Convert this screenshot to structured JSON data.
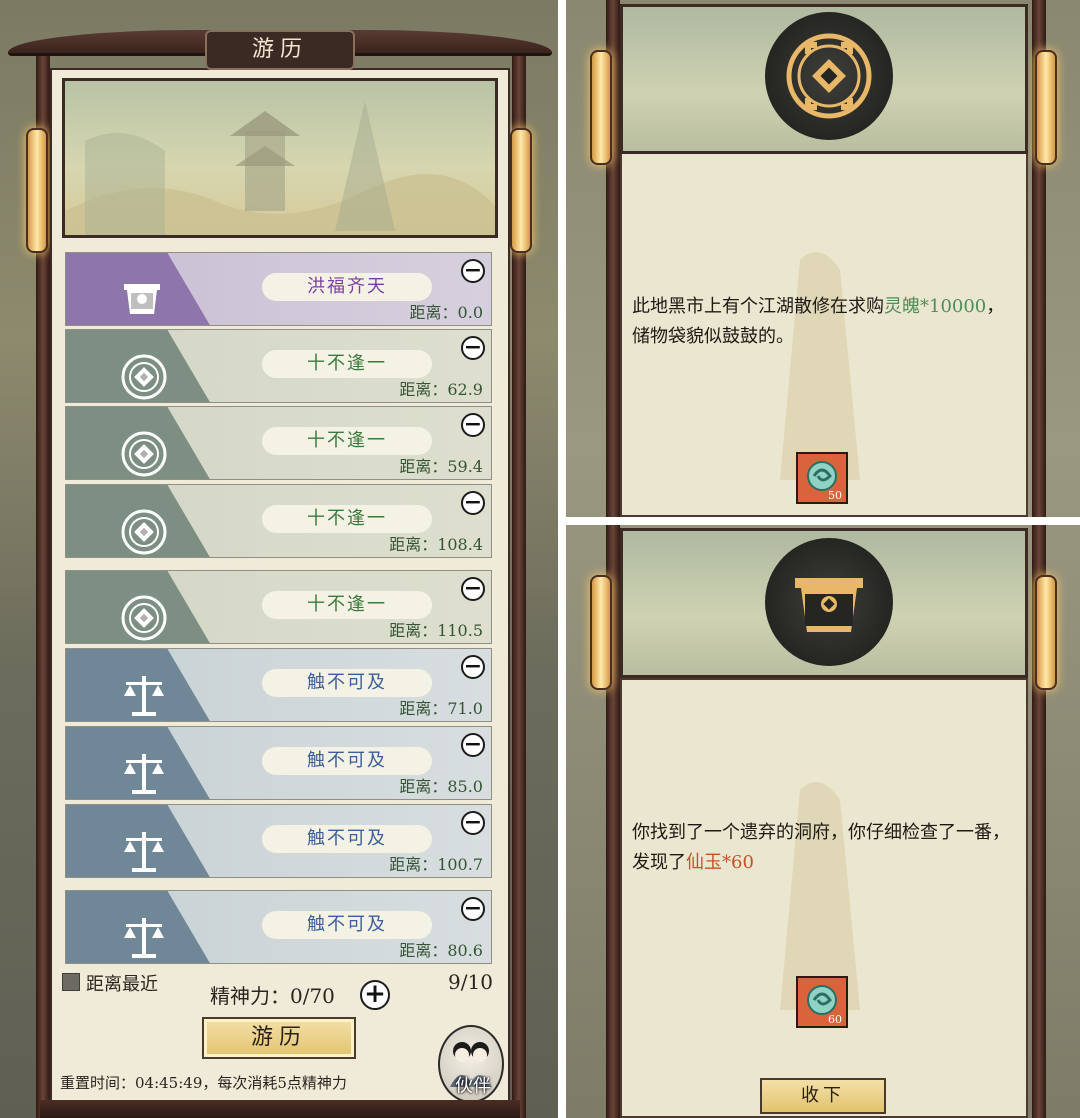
{
  "left_panel": {
    "title": "游历",
    "entries": [
      {
        "name": "洪福齐天",
        "distance": "距离：0.0",
        "color": "#7a3fa0",
        "style": "purple",
        "icon": "chest-icon"
      },
      {
        "name": "十不逢一",
        "distance": "距离：62.9",
        "color": "#3a7a3c",
        "style": "green",
        "icon": "coin-icon"
      },
      {
        "name": "十不逢一",
        "distance": "距离：59.4",
        "color": "#3a7a3c",
        "style": "green",
        "icon": "coin-icon"
      },
      {
        "name": "十不逢一",
        "distance": "距离：108.4",
        "color": "#3a7a3c",
        "style": "green",
        "icon": "coin-icon"
      },
      {
        "name": "十不逢一",
        "distance": "距离：110.5",
        "color": "#3a7a3c",
        "style": "green",
        "icon": "coin-icon"
      },
      {
        "name": "触不可及",
        "distance": "距离：71.0",
        "color": "#3d5e9c",
        "style": "blue",
        "icon": "scale-icon"
      },
      {
        "name": "触不可及",
        "distance": "距离：85.0",
        "color": "#3d5e9c",
        "style": "blue",
        "icon": "scale-icon"
      },
      {
        "name": "触不可及",
        "distance": "距离：100.7",
        "color": "#3d5e9c",
        "style": "blue",
        "icon": "scale-icon"
      },
      {
        "name": "触不可及",
        "distance": "距离：80.6",
        "color": "#3d5e9c",
        "style": "blue",
        "icon": "scale-icon"
      }
    ],
    "sort_label": "距离最近",
    "stamina_label": "精神力：0/70",
    "count": "9/10",
    "travel_button": "游历",
    "partner_label": "伙伴",
    "reset_text": "重置时间：04:45:49，每次消耗5点精神力"
  },
  "event_1": {
    "text_before": "此地黑市上有个江湖散修在求购",
    "highlight": "灵魄*10000",
    "text_after": "，储物袋貌似鼓鼓的。",
    "highlight_color": "#4f8d5a",
    "item_qty": "50",
    "icon": "coin-icon"
  },
  "event_2": {
    "text_before": "你找到了一个遗弃的洞府，你仔细检查了一番，发现了",
    "highlight": "仙玉*60",
    "highlight_color": "#c8502a",
    "item_qty": "60",
    "accept_button": "收下",
    "icon": "chest-icon"
  }
}
